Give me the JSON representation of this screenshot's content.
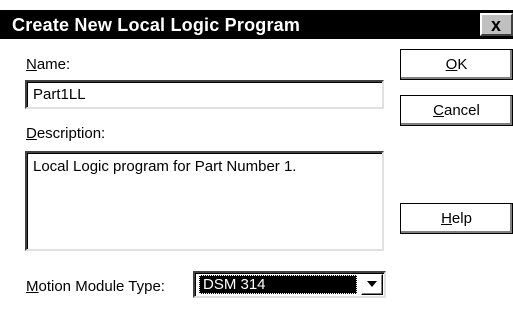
{
  "window": {
    "title": "Create New Local Logic Program",
    "close_glyph": "x"
  },
  "form": {
    "name_label_key": "N",
    "name_label_rest": "ame:",
    "name_value": "Part1LL",
    "description_label_key": "D",
    "description_label_rest": "escription:",
    "description_value": "Local Logic program for Part Number 1.",
    "motion_label_key": "M",
    "motion_label_rest": "otion Module Type:",
    "motion_value": "DSM 314"
  },
  "buttons": {
    "ok_key": "O",
    "ok_rest": "K",
    "cancel_key": "C",
    "cancel_rest": "ancel",
    "help_key": "H",
    "help_rest": "elp"
  },
  "icons": {
    "close": "close-icon",
    "dropdown": "chevron-down-icon"
  },
  "colors": {
    "titlebar": "#000000",
    "title_text": "#ffffff",
    "selection": "#000000"
  }
}
